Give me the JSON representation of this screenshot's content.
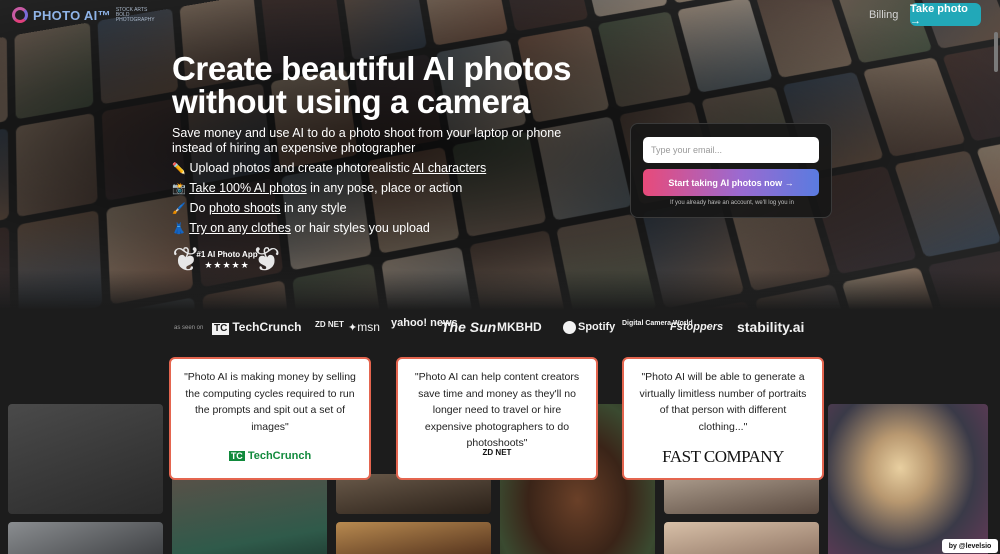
{
  "header": {
    "logo_text": "PHOTO AI™",
    "logo_tagline": "STOCK ARTS\nBOLD PHOTOGRAPHY",
    "billing_link": "Billing",
    "take_photo_button": "Take photo →"
  },
  "hero": {
    "headline": "Create beautiful AI photos without using a camera",
    "subheadline": "Save money and use AI to do a photo shoot from your laptop or phone instead of hiring an expensive photographer",
    "features": [
      {
        "icon": "pencil-icon",
        "emoji": "✏️",
        "before": "Upload photos and create photorealistic ",
        "link": "AI characters",
        "after": ""
      },
      {
        "icon": "camera-icon",
        "emoji": "📸",
        "before": "",
        "link": "Take 100% AI photos",
        "after": " in any pose, place or action"
      },
      {
        "icon": "brush-icon",
        "emoji": "🖌️",
        "before": "Do ",
        "link": "photo shoots",
        "after": " in any style"
      },
      {
        "icon": "dress-icon",
        "emoji": "👗",
        "before": "",
        "link": "Try on any clothes",
        "after": " or hair styles you upload"
      }
    ],
    "award_title": "#1 AI Photo App",
    "award_stars": "★★★★★"
  },
  "signup": {
    "email_placeholder": "Type your email...",
    "submit_button": "Start taking AI photos now →",
    "login_note": "If you already have an account, we'll log you in"
  },
  "press": {
    "label": "as seen on",
    "logos": [
      "TechCrunch",
      "ZD NET",
      "msn",
      "yahoo! news",
      "The Sun",
      "MKBHD",
      "Spotify",
      "Digital Camera World",
      "Fstoppers",
      "stability.ai"
    ]
  },
  "quotes": [
    {
      "text": "\"Photo AI is making money by selling the computing cycles required to run the prompts and spit out a set of images\"",
      "source": "TechCrunch"
    },
    {
      "text": "\"Photo AI can help content creators save time and money as they'll no longer need to travel or hire expensive photographers to do photoshoots\"",
      "source": "ZD NET"
    },
    {
      "text": "\"Photo AI will be able to generate a virtually limitless number of portraits of that person with different clothing...\"",
      "source": "FAST COMPANY"
    }
  ],
  "footer": {
    "by_label": "by @levelsio"
  },
  "colors": {
    "accent_teal": "#22a8b8",
    "quote_border": "#e4654f",
    "button_gradient_start": "#e84a7a",
    "button_gradient_end": "#5a7be0"
  }
}
